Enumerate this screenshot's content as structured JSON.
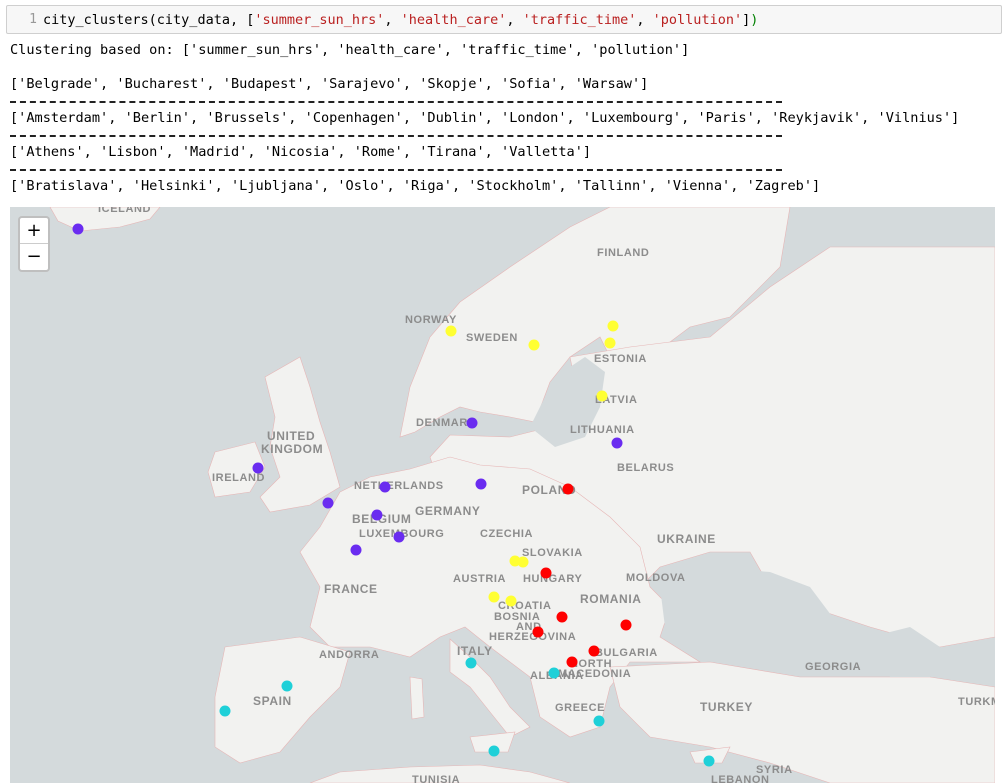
{
  "cell": {
    "line_number": "1",
    "code": {
      "func": "city_clusters",
      "open": "(city_data, ",
      "bracket_open": "[",
      "args": [
        "'summer_sun_hrs'",
        "'health_care'",
        "'traffic_time'",
        "'pollution'"
      ],
      "sep": ", ",
      "bracket_close": "]",
      "close": ")"
    }
  },
  "output": {
    "clustering_line": "Clustering based on: ['summer_sun_hrs', 'health_care', 'traffic_time', 'pollution']",
    "clusters": [
      "['Belgrade', 'Bucharest', 'Budapest', 'Sarajevo', 'Skopje', 'Sofia', 'Warsaw']",
      "['Amsterdam', 'Berlin', 'Brussels', 'Copenhagen', 'Dublin', 'London', 'Luxembourg', 'Paris', 'Reykjavik', 'Vilnius']",
      "['Athens', 'Lisbon', 'Madrid', 'Nicosia', 'Rome', 'Tirana', 'Valletta']",
      "['Bratislava', 'Helsinki', 'Ljubljana', 'Oslo', 'Riga', 'Stockholm', 'Tallinn', 'Vienna', 'Zagreb']"
    ]
  },
  "map": {
    "zoom_in": "+",
    "zoom_out": "−",
    "colors": {
      "sea": "#d4dadc",
      "land": "#f2f2f0",
      "border": "#e6b6b6",
      "cluster_red": "#ff0000",
      "cluster_purple": "#6a2cf0",
      "cluster_cyan": "#1fd0d8",
      "cluster_yellow": "#ffff33"
    },
    "labels": [
      "ICELAND",
      "FINLAND",
      "NORWAY",
      "SWEDEN",
      "ESTONIA",
      "LATVIA",
      "DENMARK",
      "LITHUANIA",
      "UNITED",
      "KINGDOM",
      "IRELAND",
      "BELARUS",
      "NETHERLANDS",
      "POLAND",
      "GERMANY",
      "BELGIUM",
      "LUXEMBOURG",
      "CZECHIA",
      "SLOVAKIA",
      "UKRAINE",
      "MOLDOVA",
      "AUSTRIA",
      "HUNGARY",
      "FRANCE",
      "ROMANIA",
      "CROATIA",
      "BOSNIA",
      "AND",
      "HERZEGOVINA",
      "ANDORRA",
      "ITALY",
      "BULGARIA",
      "NORTH",
      "MACEDONIA",
      "ALBANIA",
      "GEORGIA",
      "SPAIN",
      "GREECE",
      "TURKEY",
      "TURKM",
      "SYRIA",
      "LEBANON",
      "TUNISIA"
    ],
    "markers": [
      {
        "city": "Reykjavik",
        "cluster": "purple"
      },
      {
        "city": "Oslo",
        "cluster": "yellow"
      },
      {
        "city": "Stockholm",
        "cluster": "yellow"
      },
      {
        "city": "Helsinki",
        "cluster": "yellow"
      },
      {
        "city": "Tallinn",
        "cluster": "yellow"
      },
      {
        "city": "Riga",
        "cluster": "yellow"
      },
      {
        "city": "Copenhagen",
        "cluster": "purple"
      },
      {
        "city": "Vilnius",
        "cluster": "purple"
      },
      {
        "city": "Dublin",
        "cluster": "purple"
      },
      {
        "city": "London",
        "cluster": "purple"
      },
      {
        "city": "Amsterdam",
        "cluster": "purple"
      },
      {
        "city": "Berlin",
        "cluster": "purple"
      },
      {
        "city": "Brussels",
        "cluster": "purple"
      },
      {
        "city": "Luxembourg",
        "cluster": "purple"
      },
      {
        "city": "Paris",
        "cluster": "purple"
      },
      {
        "city": "Warsaw",
        "cluster": "red"
      },
      {
        "city": "Vienna",
        "cluster": "yellow"
      },
      {
        "city": "Bratislava",
        "cluster": "yellow"
      },
      {
        "city": "Budapest",
        "cluster": "red"
      },
      {
        "city": "Ljubljana",
        "cluster": "yellow"
      },
      {
        "city": "Zagreb",
        "cluster": "yellow"
      },
      {
        "city": "Belgrade",
        "cluster": "red"
      },
      {
        "city": "Bucharest",
        "cluster": "red"
      },
      {
        "city": "Sarajevo",
        "cluster": "red"
      },
      {
        "city": "Sofia",
        "cluster": "red"
      },
      {
        "city": "Skopje",
        "cluster": "red"
      },
      {
        "city": "Rome",
        "cluster": "cyan"
      },
      {
        "city": "Tirana",
        "cluster": "cyan"
      },
      {
        "city": "Madrid",
        "cluster": "cyan"
      },
      {
        "city": "Lisbon",
        "cluster": "cyan"
      },
      {
        "city": "Athens",
        "cluster": "cyan"
      },
      {
        "city": "Valletta",
        "cluster": "cyan"
      },
      {
        "city": "Nicosia",
        "cluster": "cyan"
      }
    ]
  }
}
